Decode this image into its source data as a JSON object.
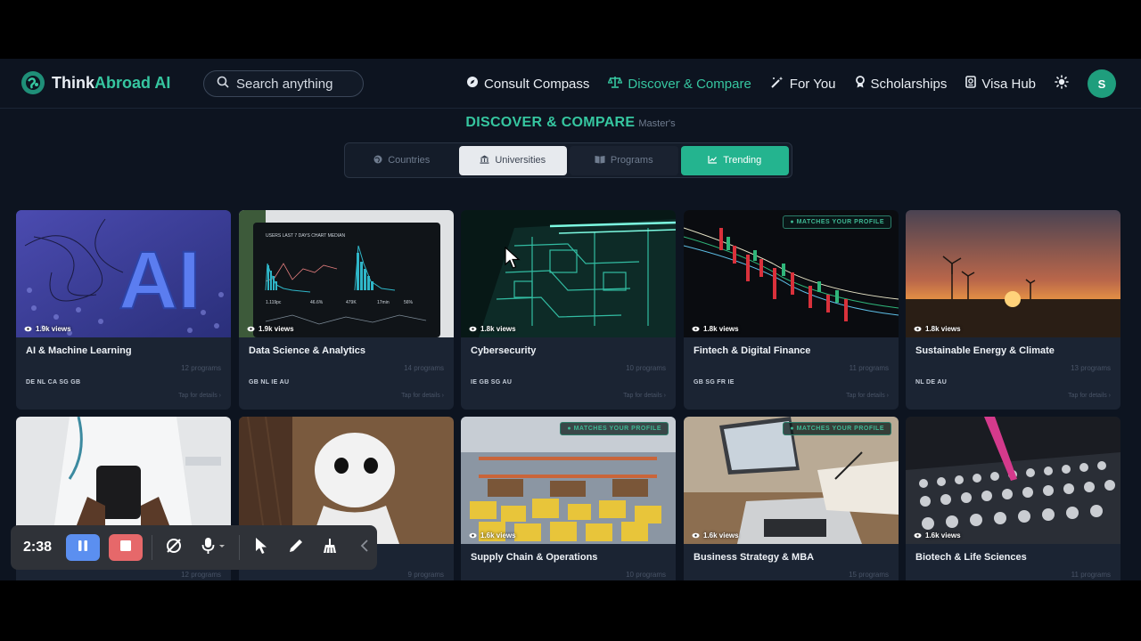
{
  "brand": {
    "name_part1": "Think",
    "name_part2": "Abroad AI"
  },
  "search": {
    "placeholder": "Search anything"
  },
  "nav": [
    {
      "label": "Consult Compass",
      "icon": "compass-icon",
      "active": false
    },
    {
      "label": "Discover & Compare",
      "icon": "scale-icon",
      "active": true
    },
    {
      "label": "For You",
      "icon": "magic-wand-icon",
      "active": false
    },
    {
      "label": "Scholarships",
      "icon": "award-icon",
      "active": false
    },
    {
      "label": "Visa Hub",
      "icon": "passport-icon",
      "active": false
    }
  ],
  "user": {
    "avatar_initial": "S"
  },
  "page": {
    "title": "DISCOVER & COMPARE",
    "subtitle": "Master's"
  },
  "tabs": [
    {
      "label": "Countries",
      "icon": "globe-icon"
    },
    {
      "label": "Universities",
      "icon": "university-icon"
    },
    {
      "label": "Programs",
      "icon": "book-icon"
    },
    {
      "label": "Trending",
      "icon": "trend-icon"
    }
  ],
  "cards": [
    {
      "title": "AI & Machine Learning",
      "views": "1.9k views",
      "programs": "12 programs",
      "countries": "DE NL CA SG GB",
      "tap": "Tap for details",
      "badge": ""
    },
    {
      "title": "Data Science & Analytics",
      "views": "1.9k views",
      "programs": "14 programs",
      "countries": "GB NL IE AU",
      "tap": "Tap for details",
      "badge": ""
    },
    {
      "title": "Cybersecurity",
      "views": "1.8k views",
      "programs": "10 programs",
      "countries": "IE GB SG AU",
      "tap": "Tap for details",
      "badge": ""
    },
    {
      "title": "Fintech & Digital Finance",
      "views": "1.8k views",
      "programs": "11 programs",
      "countries": "GB SG FR IE",
      "tap": "Tap for details",
      "badge": "MATCHES YOUR PROFILE"
    },
    {
      "title": "Sustainable Energy & Climate",
      "views": "1.8k views",
      "programs": "13 programs",
      "countries": "NL DE AU",
      "tap": "Tap for details",
      "badge": ""
    },
    {
      "title": "",
      "views": "",
      "programs": "12 programs",
      "countries": "",
      "tap": "",
      "badge": ""
    },
    {
      "title": "",
      "views": "",
      "programs": "9 programs",
      "countries": "",
      "tap": "",
      "badge": ""
    },
    {
      "title": "Supply Chain & Operations",
      "views": "1.6k views",
      "programs": "10 programs",
      "countries": "",
      "tap": "",
      "badge": "MATCHES YOUR PROFILE"
    },
    {
      "title": "Business Strategy & MBA",
      "views": "1.6k views",
      "programs": "15 programs",
      "countries": "",
      "tap": "",
      "badge": "MATCHES YOUR PROFILE"
    },
    {
      "title": "Biotech & Life Sciences",
      "views": "1.6k views",
      "programs": "11 programs",
      "countries": "",
      "tap": "",
      "badge": ""
    }
  ],
  "recorder": {
    "time": "2:38"
  },
  "colors": {
    "accent": "#36c6a0",
    "background": "#0d1420",
    "card": "#1b2433",
    "tab_active": "#24b48f"
  }
}
